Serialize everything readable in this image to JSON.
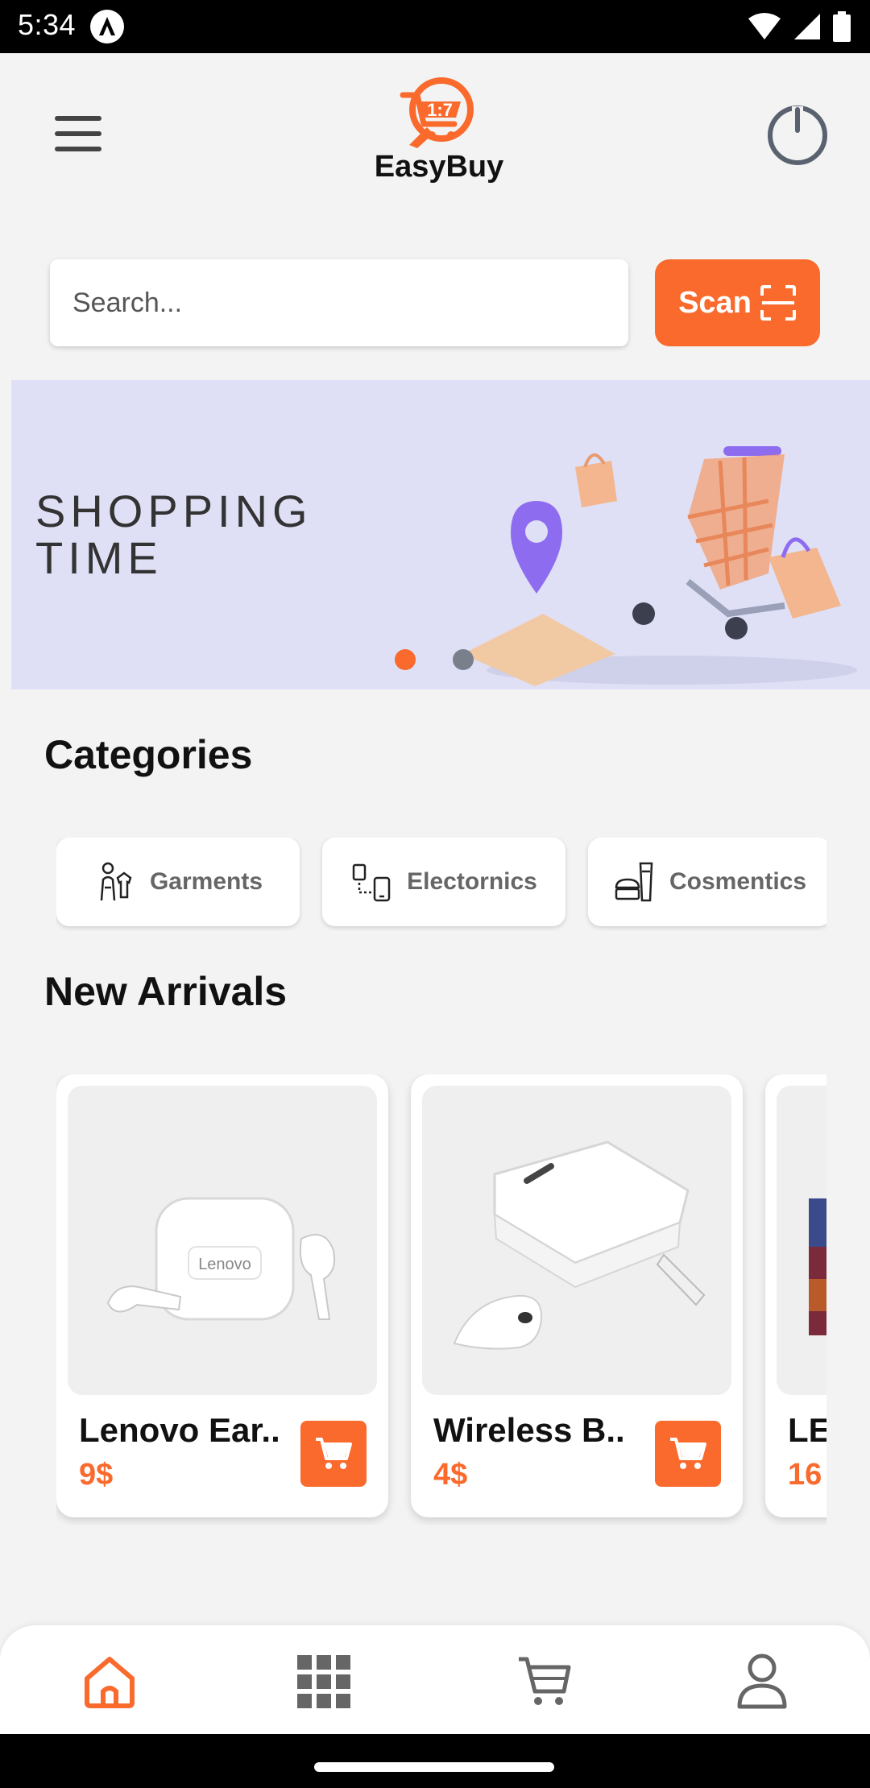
{
  "status_bar": {
    "time": "5:34"
  },
  "header": {
    "brand": "EasyBuy",
    "menu_icon": "hamburger-menu-icon",
    "logo_icon": "cart-logo-icon",
    "power_icon": "power-icon"
  },
  "search": {
    "placeholder": "Search..."
  },
  "scan": {
    "label": "Scan",
    "icon": "scan-frame-icon"
  },
  "banner": {
    "line1": "SHOPPING",
    "line2": "TIME",
    "active_slide": 1,
    "slide_count": 2
  },
  "categories": {
    "title": "Categories",
    "items": [
      {
        "label": "Garments",
        "icon": "garment-icon"
      },
      {
        "label": "Electornics",
        "icon": "devices-icon"
      },
      {
        "label": "Cosmentics",
        "icon": "cosmetics-icon"
      }
    ]
  },
  "new_arrivals": {
    "title": "New Arrivals",
    "products": [
      {
        "name": "Lenovo Ear..",
        "price": "9$",
        "image_text": "Lenovo"
      },
      {
        "name": "Wireless B..",
        "price": "4$"
      },
      {
        "name": "LE",
        "price": "16"
      }
    ]
  },
  "bottom_nav": {
    "items": [
      {
        "icon": "home-icon",
        "active": true
      },
      {
        "icon": "grid-icon",
        "active": false
      },
      {
        "icon": "cart-icon",
        "active": false
      },
      {
        "icon": "user-icon",
        "active": false
      }
    ]
  },
  "colors": {
    "accent": "#f96a2c",
    "banner_bg": "#dfe0f6",
    "dot_inactive": "#7a7f8c"
  }
}
